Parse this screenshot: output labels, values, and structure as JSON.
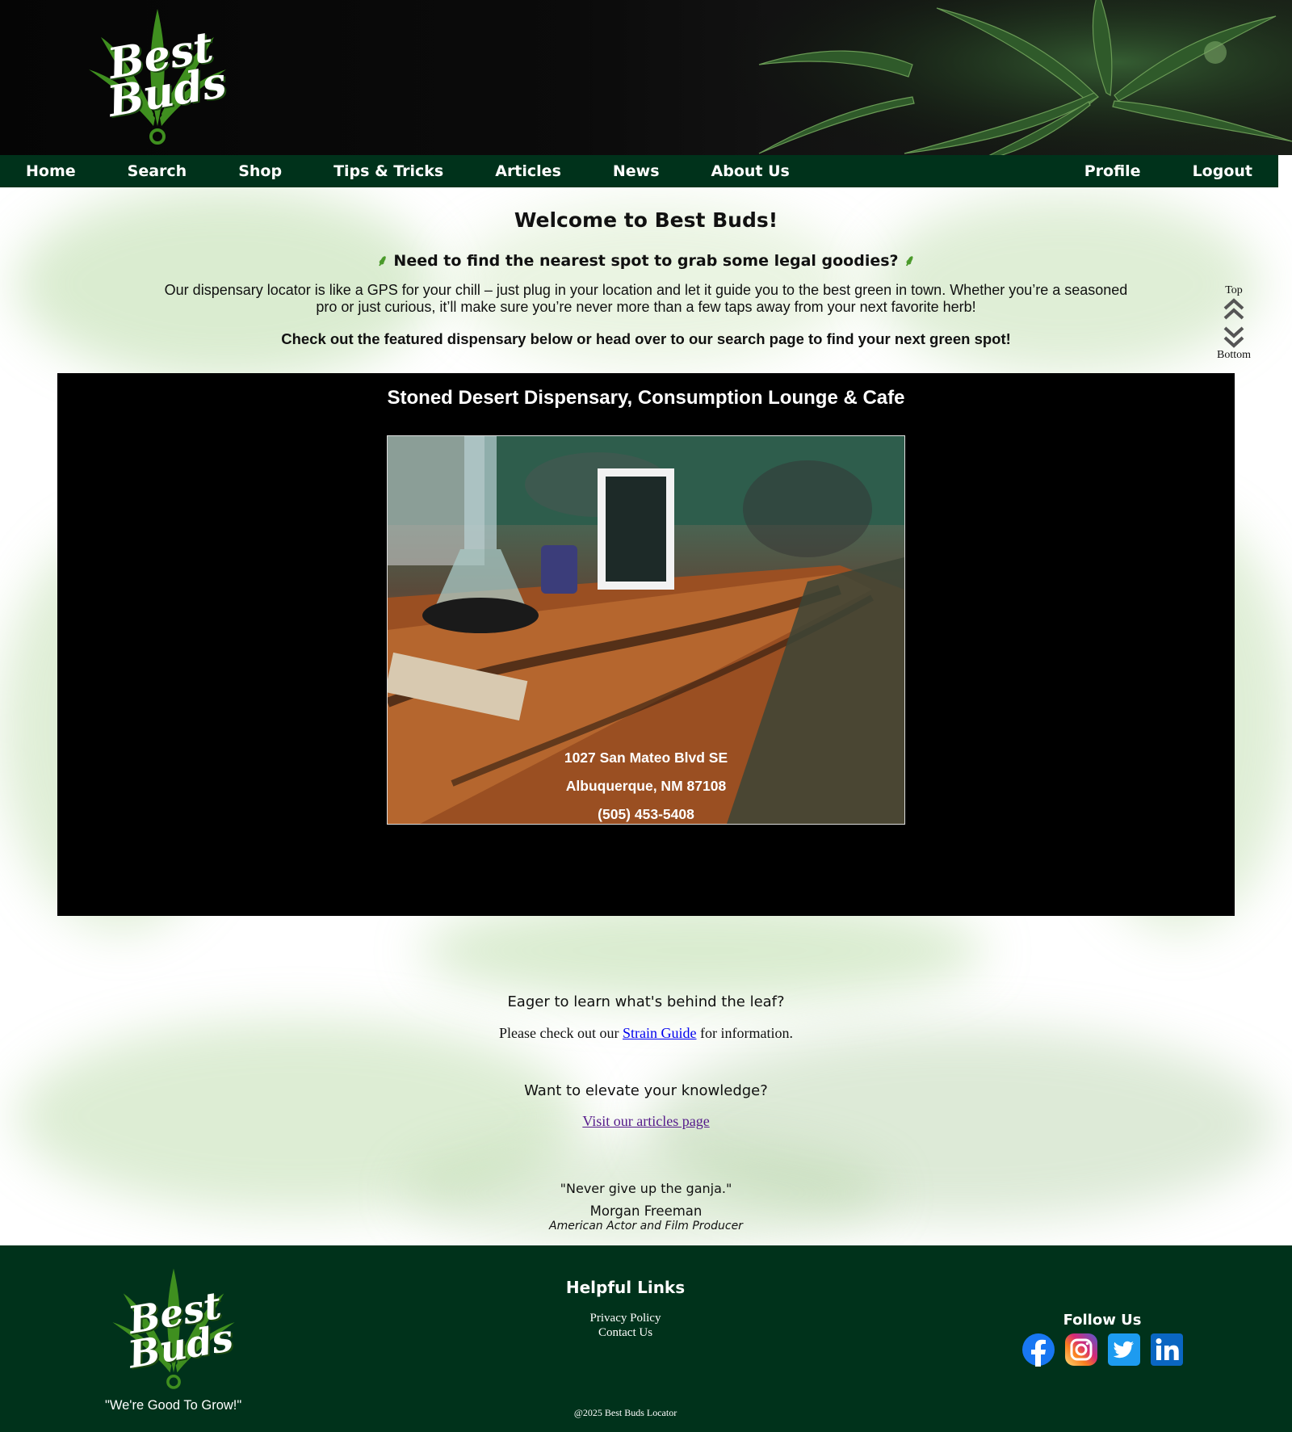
{
  "brand": {
    "logo_word_1": "Best",
    "logo_word_2": "Buds",
    "slogan": "\"We're Good To Grow!\""
  },
  "nav": {
    "home": "Home",
    "search": "Search",
    "shop": "Shop",
    "tips": "Tips & Tricks",
    "articles": "Articles",
    "news": "News",
    "about": "About Us",
    "profile": "Profile",
    "logout": "Logout"
  },
  "intro": {
    "welcome": "Welcome to Best Buds!",
    "need": "Need to find the nearest spot to grab some legal goodies?",
    "paragraph": "Our dispensary locator is like a GPS for your chill – just plug in your location and let it guide you to the best green in town. Whether you’re a seasoned pro or just curious, it’ll make sure you’re never more than a few taps away from your next favorite herb!",
    "check": "Check out the featured dispensary below or head over to our search page to find your next green spot!"
  },
  "scroller": {
    "top": "Top",
    "bottom": "Bottom"
  },
  "featured": {
    "name": "Stoned Desert Dispensary, Consumption Lounge & Cafe",
    "address_line1": "1027 San Mateo Blvd SE",
    "address_line2": "Albuquerque, NM 87108",
    "phone": "(505) 453-5408"
  },
  "learn": {
    "eager": "Eager to learn what's behind the leaf?",
    "check_prefix": "Please check out our",
    "strain_link": "Strain Guide",
    "check_suffix": "for information.",
    "elevate": "Want to elevate your knowledge?",
    "articles_link": "Visit our articles page"
  },
  "quote": {
    "text": "\"Never give up the ganja.\"",
    "author": "Morgan Freeman",
    "role": "American Actor and Film Producer"
  },
  "footer": {
    "links_title": "Helpful Links",
    "privacy": "Privacy Policy",
    "contact": "Contact Us",
    "copyright": "@2025 Best Buds Locator",
    "follow": "Follow Us",
    "socials": [
      "facebook-icon",
      "instagram-icon",
      "twitter-icon",
      "linkedin-icon"
    ]
  },
  "colors": {
    "nav_bg": "#00321b",
    "footer_bg": "#00321b",
    "leaf_green": "#3f8f1f",
    "featured_bg": "#000000"
  }
}
